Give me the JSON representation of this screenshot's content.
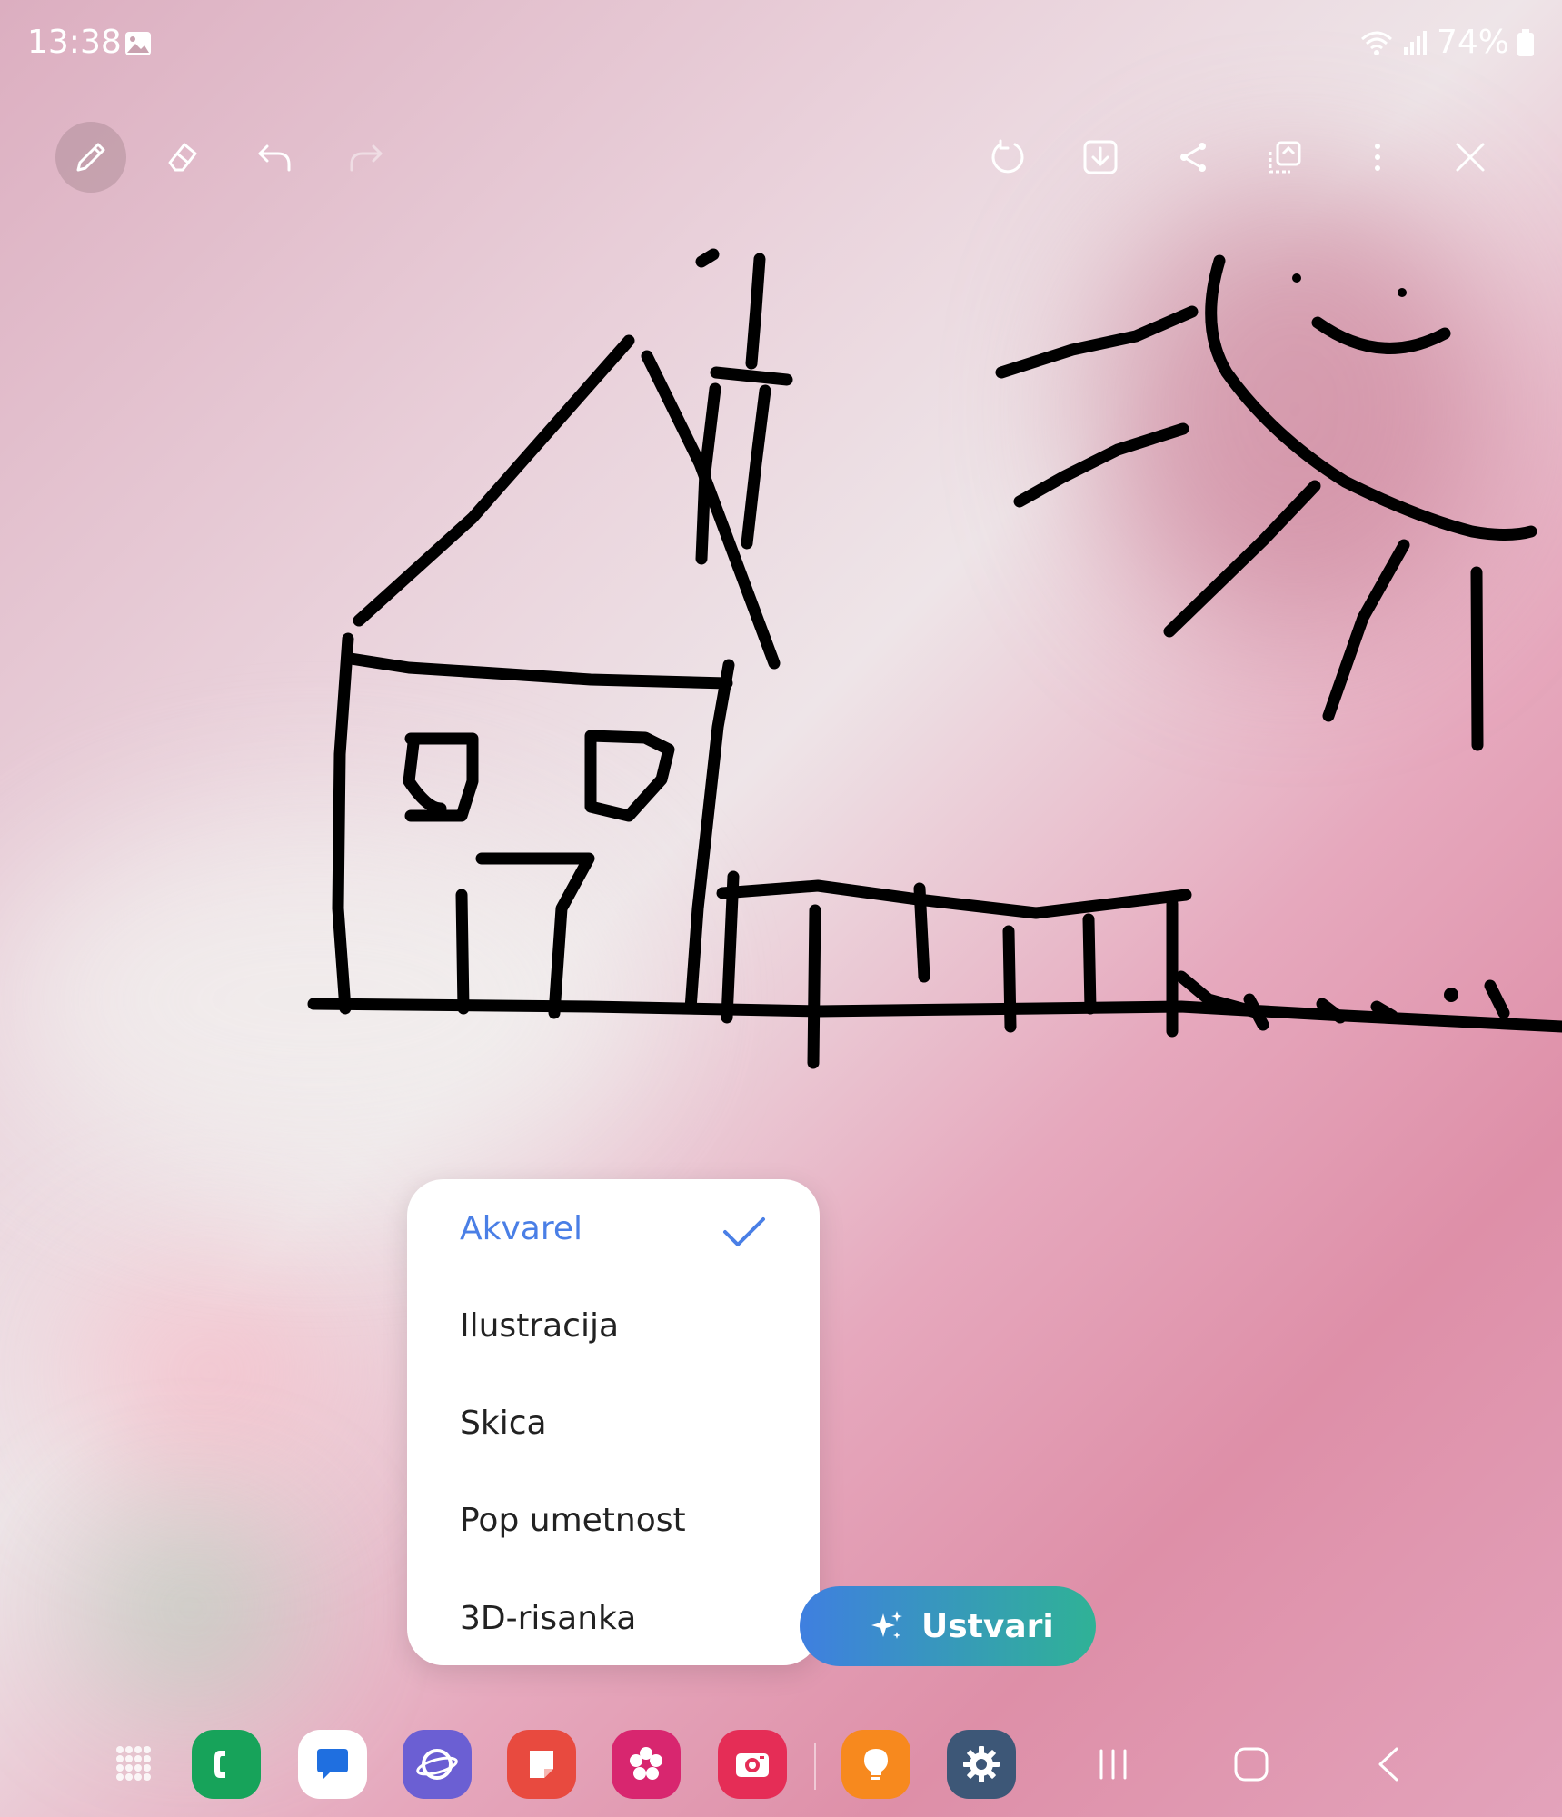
{
  "status_bar": {
    "time": "13:38",
    "battery": "74%"
  },
  "toolbar": {
    "left_icons": [
      "pen-icon",
      "eraser-icon",
      "undo-icon",
      "redo-icon"
    ],
    "right_icons": [
      "reset-icon",
      "download-icon",
      "share-icon",
      "copy-icon",
      "more-icon",
      "close-icon"
    ]
  },
  "style_menu": {
    "items": [
      "Akvarel",
      "Ilustracija",
      "Skica",
      "Pop umetnost",
      "3D-risanka"
    ],
    "selected": "Akvarel",
    "accent": "#4a7fe6"
  },
  "create_button": {
    "label": "Ustvari"
  },
  "dock": {
    "apps": [
      "apps-grid-icon",
      "phone-icon",
      "messages-icon",
      "internet-icon",
      "notes-icon",
      "gallery-icon",
      "camera-icon",
      "tips-icon",
      "settings-icon"
    ]
  },
  "navigation": [
    "recents-icon",
    "home-icon",
    "back-icon"
  ]
}
